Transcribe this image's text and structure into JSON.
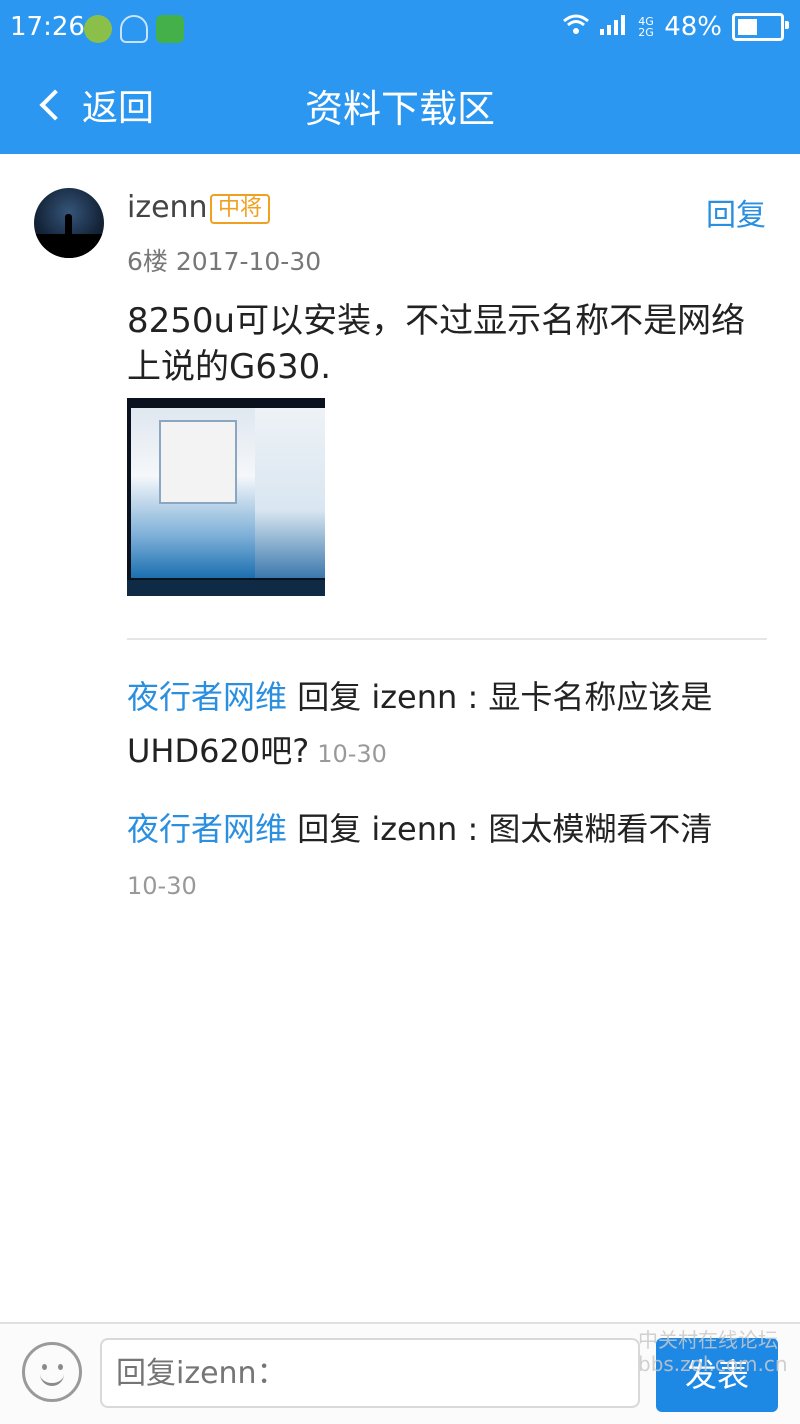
{
  "status_bar": {
    "time": "17:26",
    "network": "4G 2G",
    "battery_percent": "48%",
    "battery_level": 0.48
  },
  "nav": {
    "back_label": "返回",
    "title": "资料下载区"
  },
  "post": {
    "username": "izenn",
    "rank": "中将",
    "reply_label": "回复",
    "floor_date": "6楼 2017-10-30",
    "content": "8250u可以安装，不过显示名称不是网络上说的G630.",
    "comments": [
      {
        "author": "夜行者网维",
        "text": " 回复 izenn : 显卡名称应该是UHD620吧?",
        "date": "10-30"
      },
      {
        "author": "夜行者网维",
        "text": " 回复 izenn : 图太模糊看不清",
        "date": "10-30"
      }
    ]
  },
  "composer": {
    "placeholder": "回复izenn：",
    "send_label": "发表"
  },
  "watermark": {
    "line1": "中关村在线论坛",
    "line2": "bbs.zol.com.cn"
  },
  "colors": {
    "header_blue": "#2b97f0",
    "link_blue": "#2b8fe0",
    "rank_orange": "#f0a020",
    "send_blue": "#1e88e5"
  },
  "icons": [
    "back-chevron-icon",
    "wifi-icon",
    "signal-icon",
    "battery-icon",
    "emoji-icon"
  ]
}
